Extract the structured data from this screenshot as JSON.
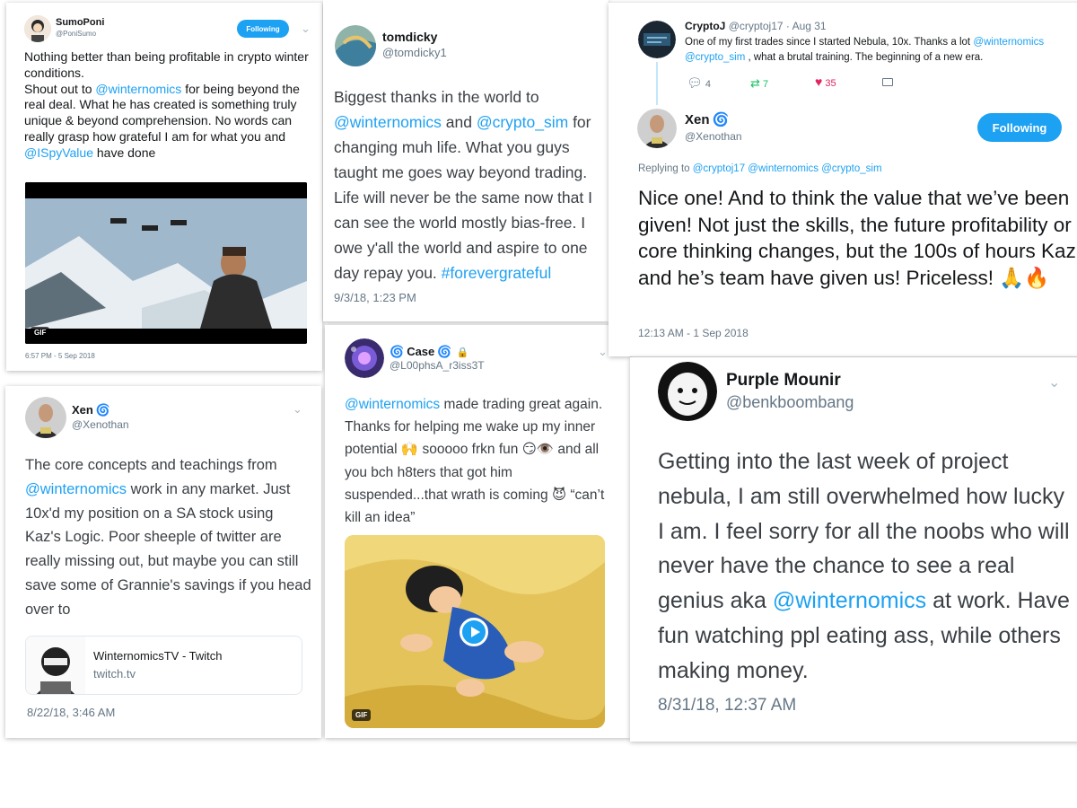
{
  "colors": {
    "accent": "#1da1f2",
    "like": "#e0245e",
    "retweet": "#17bf63",
    "muted": "#657786"
  },
  "tweets": {
    "sumoponi": {
      "name": "SumoPoni",
      "handle": "@PoniSumo",
      "follow_label": "Following",
      "text_parts": [
        "Nothing better than being profitable in crypto winter conditions.",
        "Shout out to ",
        "@winternomics",
        " for being beyond the real deal. What he has created is something truly unique & beyond comprehension. No words can really grasp how grateful I am for what you and ",
        "@ISpyValue",
        " have done"
      ],
      "media_badge": "GIF",
      "time": "6:57 PM - 5 Sep 2018"
    },
    "tomdicky": {
      "name": "tomdicky",
      "handle": "@tomdicky1",
      "text_parts": [
        "Biggest thanks in the world to ",
        "@winternomics",
        " and ",
        "@crypto_sim",
        " for changing muh life. What you guys taught me goes way beyond trading. Life will never be the same now that I can see the world mostly bias-free. I owe y'all the world and aspire to one day repay you. ",
        "#forevergrateful"
      ],
      "time": "9/3/18, 1:23 PM"
    },
    "cryptoj": {
      "name": "CryptoJ",
      "handle": "@cryptoj17",
      "date": "· Aug 31",
      "text_parts": [
        "One of my first trades since I started Nebula, 10x. Thanks a lot ",
        "@winternomics",
        "@crypto_sim",
        " , what a brutal training. The beginning of a new era."
      ],
      "actions": {
        "replies": "4",
        "retweets": "7",
        "likes": "35"
      }
    },
    "xen_reply": {
      "name": "Xen",
      "handle": "@Xenothan",
      "follow_label": "Following",
      "replying_label": "Replying to",
      "replying_handles": "@cryptoj17 @winternomics @crypto_sim",
      "text": "Nice one! And to think the value that we’ve been given! Not just the skills, the future profitability or core thinking changes, but the 100s of hours Kaz and he’s team have given us! Priceless! 🙏🔥",
      "time": "12:13 AM - 1 Sep 2018"
    },
    "xen": {
      "name": "Xen",
      "handle": "@Xenothan",
      "text_parts": [
        "The core concepts and teachings from ",
        "@winternomics",
        " work in any market. Just 10x'd my position on a SA stock using Kaz's Logic. Poor sheeple of twitter are really missing out, but maybe you can still save some of Grannie's savings if you head over to"
      ],
      "link_card": {
        "title": "WinternomicsTV - Twitch",
        "domain": "twitch.tv"
      },
      "time": "8/22/18, 3:46 AM"
    },
    "case": {
      "name": "Case",
      "handle": "@L00phsA_r3iss3T",
      "text_parts": [
        "@winternomics",
        " made trading great again.  Thanks for helping me wake up my inner potential 🙌 sooooo frkn fun 😏👁️ and all you bch h8ters that got him suspended...that wrath is coming 😈 “can’t kill an idea”"
      ],
      "media_badge": "GIF"
    },
    "purple": {
      "name": "Purple Mounir",
      "handle": "@benkboombang",
      "text_parts": [
        "Getting into the last week of project nebula, I am still overwhelmed how lucky I am. I feel sorry for all the noobs who will never have the chance to see a real genius aka ",
        "@winternomics",
        " at work. Have fun watching ppl eating ass, while others making money."
      ],
      "time": "8/31/18, 12:37 AM"
    }
  }
}
